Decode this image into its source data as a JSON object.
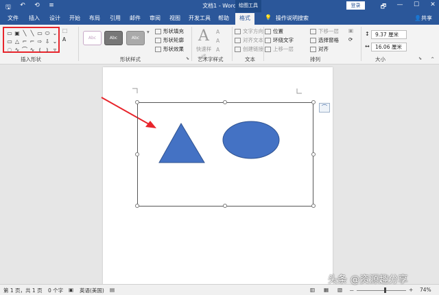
{
  "titlebar": {
    "title": "文档1 - Word",
    "context_group": "绘图工具",
    "login": "登录",
    "qat": [
      "🖫",
      "↶",
      "⟲",
      "≡"
    ],
    "winctl": [
      "🗗",
      "—",
      "☐",
      "✕"
    ]
  },
  "tabs": [
    "文件",
    "插入",
    "设计",
    "开始",
    "布局",
    "引用",
    "邮件",
    "审阅",
    "视图",
    "开发工具",
    "帮助",
    "格式"
  ],
  "active_tab": "格式",
  "tell_me": "操作说明搜索",
  "share": "共享",
  "ribbon": {
    "groups": {
      "insert_shapes": "插入形状",
      "shape_styles": "形状样式",
      "wordart_styles": "艺术字样式",
      "text": "文本",
      "arrange": "排列",
      "size": "大小"
    },
    "style_sample": "Abc",
    "shape_fill": "形状填充",
    "shape_outline": "形状轮廓",
    "shape_effects": "形状效果",
    "quick_styles": "快速样式",
    "text_direction": "文字方向",
    "align_text": "对齐文本",
    "create_link": "创建链接",
    "position": "位置",
    "wrap_text": "环绕文字",
    "bring_forward": "上移一层",
    "send_backward": "下移一层",
    "selection_pane": "选择窗格",
    "align": "对齐",
    "height": "9.37 厘米",
    "width": "16.06 厘米",
    "shape_glyphs": [
      "▭",
      "▣",
      "╲",
      "╲",
      "▭",
      "⬭",
      "⌄",
      "▭",
      "△",
      "⌐",
      "⌐",
      "⇨",
      "⇩",
      "⌄",
      "◌",
      "∿",
      "⌒",
      "∿",
      "⦅",
      "⦆",
      "▿"
    ]
  },
  "status": {
    "page": "第 1 页，共 1 页",
    "words": "0 个字",
    "lang": "英语(美国)",
    "zoom_minus": "－",
    "zoom_plus": "+",
    "zoom": "74%"
  },
  "watermark": "头条 @资源趣分享",
  "colors": {
    "accent": "#2b579a",
    "shape_fill": "#4472c4",
    "shape_stroke": "#2f528f",
    "annotation": "#e8242b"
  }
}
